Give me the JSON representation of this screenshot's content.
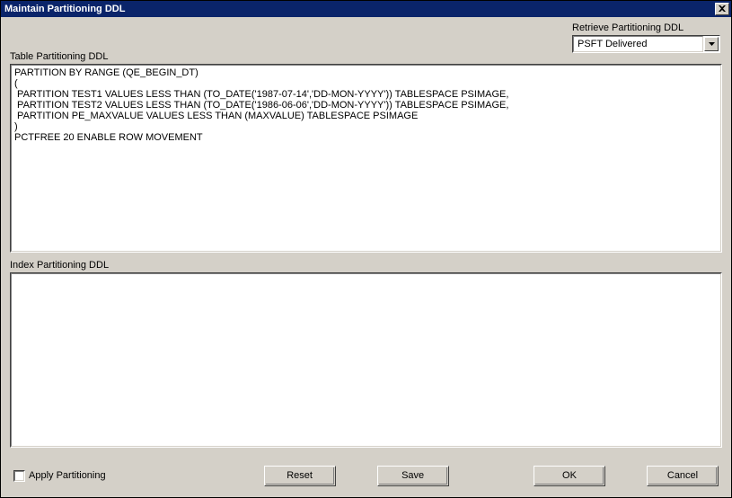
{
  "window": {
    "title": "Maintain Partitioning DDL"
  },
  "retrieve": {
    "label": "Retrieve Partitioning DDL",
    "selected": "PSFT Delivered"
  },
  "sections": {
    "table": {
      "label": "Table Partitioning DDL",
      "value": "PARTITION BY RANGE (QE_BEGIN_DT)\n(\n PARTITION TEST1 VALUES LESS THAN (TO_DATE('1987-07-14','DD-MON-YYYY')) TABLESPACE PSIMAGE,\n PARTITION TEST2 VALUES LESS THAN (TO_DATE('1986-06-06','DD-MON-YYYY')) TABLESPACE PSIMAGE,\n PARTITION PE_MAXVALUE VALUES LESS THAN (MAXVALUE) TABLESPACE PSIMAGE\n)\nPCTFREE 20 ENABLE ROW MOVEMENT"
    },
    "index": {
      "label": "Index Partitioning DDL",
      "value": ""
    }
  },
  "footer": {
    "apply_label": "Apply Partitioning",
    "reset": "Reset",
    "save": "Save",
    "ok": "OK",
    "cancel": "Cancel"
  }
}
